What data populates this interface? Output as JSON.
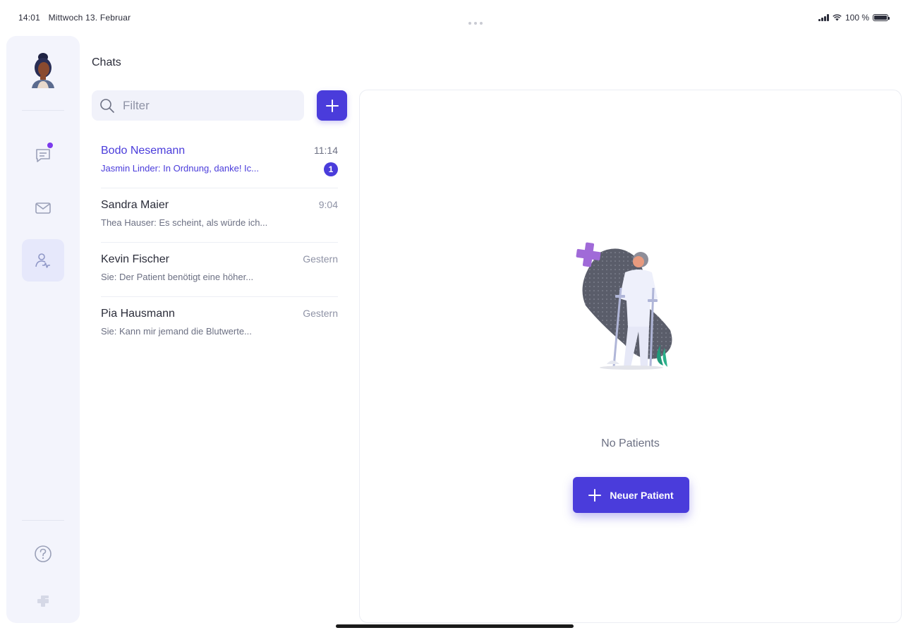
{
  "status_bar": {
    "time": "14:01",
    "date": "Mittwoch 13. Februar",
    "battery": "100 %"
  },
  "sidebar": {
    "avatar_icon": "user-avatar",
    "nav": [
      {
        "icon": "chat-icon",
        "has_notification": true
      },
      {
        "icon": "mail-icon"
      },
      {
        "icon": "patients-icon",
        "active": true
      }
    ],
    "bottom": [
      {
        "icon": "help-icon"
      },
      {
        "icon": "app-logo-icon"
      }
    ]
  },
  "chats": {
    "title": "Chats",
    "filter_placeholder": "Filter",
    "items": [
      {
        "name": "Bodo Nesemann",
        "time": "11:14",
        "preview": "Jasmin Linder: In Ordnung, danke! Ic...",
        "unread": "1"
      },
      {
        "name": "Sandra Maier",
        "time": "9:04",
        "preview": "Thea Hauser: Es scheint, als würde ich..."
      },
      {
        "name": "Kevin Fischer",
        "time": "Gestern",
        "preview": "Sie: Der Patient benötigt eine höher..."
      },
      {
        "name": "Pia Hausmann",
        "time": "Gestern",
        "preview": "Sie: Kann mir jemand die Blutwerte..."
      }
    ]
  },
  "main": {
    "empty_text": "No Patients",
    "new_patient_label": "Neuer Patient"
  },
  "colors": {
    "accent": "#4a3cdb",
    "sidebar_bg": "#f3f4fc",
    "notification": "#7c3aed"
  }
}
